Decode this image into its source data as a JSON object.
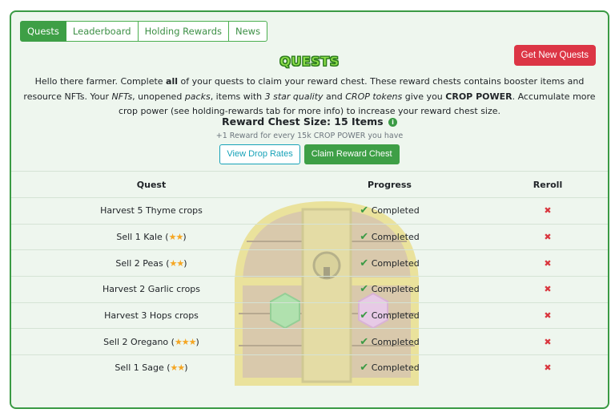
{
  "tabs": [
    {
      "label": "Quests",
      "active": true
    },
    {
      "label": "Leaderboard",
      "active": false
    },
    {
      "label": "Holding Rewards",
      "active": false
    },
    {
      "label": "News",
      "active": false
    }
  ],
  "get_new_quests_label": "Get New Quests",
  "title": "QUESTS",
  "intro": {
    "p1": "Hello there farmer. Complete ",
    "all": "all",
    "p2": " of your quests to claim your reward chest. These reward chests contains booster items and resource NFTs. Your ",
    "nfts": "NFTs",
    "p3": ", unopened ",
    "packs": "packs",
    "p4": ", items with ",
    "star_quality": "3 star quality",
    "p5": " and ",
    "crop_tokens": "CROP tokens",
    "p6": " give you ",
    "crop_power": "CROP POWER",
    "p7": ". Accumulate more crop power (see holding-rewards tab for more info) to increase your reward chest size."
  },
  "chest_size": "Reward Chest Size: 15 Items",
  "chest_note": "+1 Reward for every 15k CROP POWER you have",
  "view_drop_rates_label": "View Drop Rates",
  "claim_label": "Claim Reward Chest",
  "table": {
    "headers": {
      "quest": "Quest",
      "progress": "Progress",
      "reroll": "Reroll"
    },
    "rows": [
      {
        "quest": "Harvest 5 Thyme crops",
        "suffix": "",
        "stars": "",
        "progress": "Completed"
      },
      {
        "quest": "Sell 1 Kale (",
        "suffix": ")",
        "stars": "★★",
        "progress": "Completed"
      },
      {
        "quest": "Sell 2 Peas (",
        "suffix": ")",
        "stars": "★★",
        "progress": "Completed"
      },
      {
        "quest": "Harvest 2 Garlic crops",
        "suffix": "",
        "stars": "",
        "progress": "Completed"
      },
      {
        "quest": "Harvest 3 Hops crops",
        "suffix": "",
        "stars": "",
        "progress": "Completed"
      },
      {
        "quest": "Sell 2 Oregano (",
        "suffix": ")",
        "stars": "★★★",
        "progress": "Completed"
      },
      {
        "quest": "Sell 1 Sage (",
        "suffix": ")",
        "stars": "★★",
        "progress": "Completed"
      }
    ]
  },
  "icons": {
    "check": "check-icon",
    "cross": "close-icon",
    "info": "info-icon",
    "star": "star-icon"
  },
  "colors": {
    "accent": "#3e9f46",
    "danger": "#dc3545",
    "info": "#17a2b8",
    "star": "#f5a623"
  }
}
